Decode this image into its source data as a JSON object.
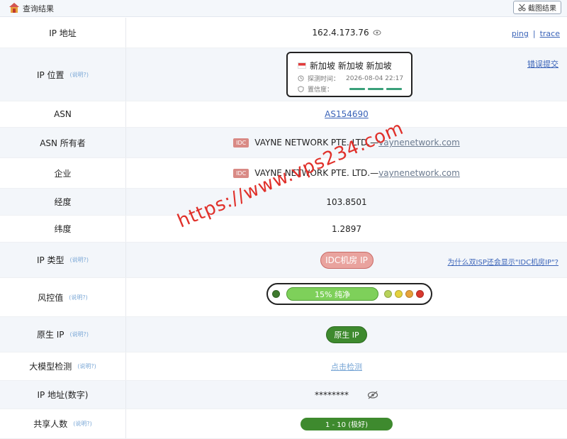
{
  "topbar": {
    "title": "查询结果",
    "screenshot_label": "截图结果"
  },
  "rows": {
    "ip": {
      "label": "IP 地址",
      "value": "162.4.173.76",
      "ping": "ping",
      "sep": "|",
      "trace": "trace"
    },
    "location": {
      "label": "IP 位置",
      "hint": "(说明?)",
      "country": "新加坡 新加坡 新加坡",
      "time_label": "探测时间：",
      "time_value": "2026-08-04 22:17",
      "conf_label": "置信度：",
      "report": "错误提交"
    },
    "asn": {
      "label": "ASN",
      "value": "AS154690"
    },
    "asn_owner": {
      "label": "ASN 所有者",
      "tag": "IDC",
      "company": "VAYNE NETWORK PTE. LTD.—",
      "domain": "vaynenetwork.com"
    },
    "enterprise": {
      "label": "企业",
      "tag": "IDC",
      "company": "VAYNE NETWORK PTE. LTD.—",
      "domain": "vaynenetwork.com"
    },
    "longitude": {
      "label": "经度",
      "value": "103.8501"
    },
    "latitude": {
      "label": "纬度",
      "value": "1.2897"
    },
    "ip_type": {
      "label": "IP 类型",
      "hint": "(说明?)",
      "value": "IDC机房 IP",
      "question": "为什么双ISP还会显示\"IDC机房IP\"?"
    },
    "risk": {
      "label": "风控值",
      "hint": "(说明?)",
      "value": "15%  纯净",
      "level": 0.15
    },
    "native": {
      "label": "原生 IP",
      "hint": "(说明?)",
      "value": "原生 IP"
    },
    "llm": {
      "label": "大模型检测",
      "hint": "(说明?)",
      "value": "点击检测"
    },
    "ip_numeric": {
      "label": "IP 地址(数字)",
      "value": "********"
    },
    "share": {
      "label": "共享人数",
      "hint": "(说明?)",
      "value": "1 - 10 (极好)"
    }
  },
  "watermark": "https://www.vps234.com",
  "colors": {
    "accent": "#3a63b8",
    "good": "#3e8a2e",
    "idc": "#e9a39e",
    "watermark": "#e0302a"
  },
  "icons": [
    "home-icon",
    "scissors-icon",
    "eye-icon",
    "clock-icon",
    "shield-icon",
    "eye-off-icon"
  ]
}
